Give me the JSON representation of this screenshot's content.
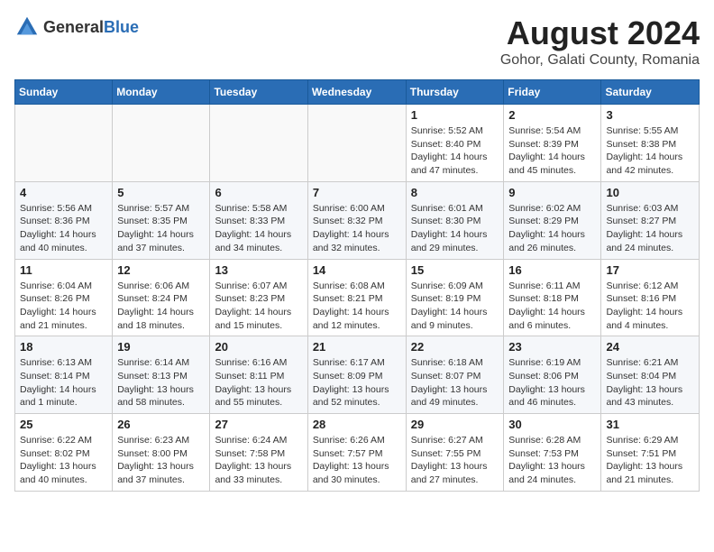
{
  "logo": {
    "general": "General",
    "blue": "Blue"
  },
  "title": "August 2024",
  "subtitle": "Gohor, Galati County, Romania",
  "days_of_week": [
    "Sunday",
    "Monday",
    "Tuesday",
    "Wednesday",
    "Thursday",
    "Friday",
    "Saturday"
  ],
  "weeks": [
    [
      {
        "day": "",
        "empty": true
      },
      {
        "day": "",
        "empty": true
      },
      {
        "day": "",
        "empty": true
      },
      {
        "day": "",
        "empty": true
      },
      {
        "day": "1",
        "sunrise": "5:52 AM",
        "sunset": "8:40 PM",
        "daylight": "14 hours and 47 minutes."
      },
      {
        "day": "2",
        "sunrise": "5:54 AM",
        "sunset": "8:39 PM",
        "daylight": "14 hours and 45 minutes."
      },
      {
        "day": "3",
        "sunrise": "5:55 AM",
        "sunset": "8:38 PM",
        "daylight": "14 hours and 42 minutes."
      }
    ],
    [
      {
        "day": "4",
        "sunrise": "5:56 AM",
        "sunset": "8:36 PM",
        "daylight": "14 hours and 40 minutes."
      },
      {
        "day": "5",
        "sunrise": "5:57 AM",
        "sunset": "8:35 PM",
        "daylight": "14 hours and 37 minutes."
      },
      {
        "day": "6",
        "sunrise": "5:58 AM",
        "sunset": "8:33 PM",
        "daylight": "14 hours and 34 minutes."
      },
      {
        "day": "7",
        "sunrise": "6:00 AM",
        "sunset": "8:32 PM",
        "daylight": "14 hours and 32 minutes."
      },
      {
        "day": "8",
        "sunrise": "6:01 AM",
        "sunset": "8:30 PM",
        "daylight": "14 hours and 29 minutes."
      },
      {
        "day": "9",
        "sunrise": "6:02 AM",
        "sunset": "8:29 PM",
        "daylight": "14 hours and 26 minutes."
      },
      {
        "day": "10",
        "sunrise": "6:03 AM",
        "sunset": "8:27 PM",
        "daylight": "14 hours and 24 minutes."
      }
    ],
    [
      {
        "day": "11",
        "sunrise": "6:04 AM",
        "sunset": "8:26 PM",
        "daylight": "14 hours and 21 minutes."
      },
      {
        "day": "12",
        "sunrise": "6:06 AM",
        "sunset": "8:24 PM",
        "daylight": "14 hours and 18 minutes."
      },
      {
        "day": "13",
        "sunrise": "6:07 AM",
        "sunset": "8:23 PM",
        "daylight": "14 hours and 15 minutes."
      },
      {
        "day": "14",
        "sunrise": "6:08 AM",
        "sunset": "8:21 PM",
        "daylight": "14 hours and 12 minutes."
      },
      {
        "day": "15",
        "sunrise": "6:09 AM",
        "sunset": "8:19 PM",
        "daylight": "14 hours and 9 minutes."
      },
      {
        "day": "16",
        "sunrise": "6:11 AM",
        "sunset": "8:18 PM",
        "daylight": "14 hours and 6 minutes."
      },
      {
        "day": "17",
        "sunrise": "6:12 AM",
        "sunset": "8:16 PM",
        "daylight": "14 hours and 4 minutes."
      }
    ],
    [
      {
        "day": "18",
        "sunrise": "6:13 AM",
        "sunset": "8:14 PM",
        "daylight": "14 hours and 1 minute."
      },
      {
        "day": "19",
        "sunrise": "6:14 AM",
        "sunset": "8:13 PM",
        "daylight": "13 hours and 58 minutes."
      },
      {
        "day": "20",
        "sunrise": "6:16 AM",
        "sunset": "8:11 PM",
        "daylight": "13 hours and 55 minutes."
      },
      {
        "day": "21",
        "sunrise": "6:17 AM",
        "sunset": "8:09 PM",
        "daylight": "13 hours and 52 minutes."
      },
      {
        "day": "22",
        "sunrise": "6:18 AM",
        "sunset": "8:07 PM",
        "daylight": "13 hours and 49 minutes."
      },
      {
        "day": "23",
        "sunrise": "6:19 AM",
        "sunset": "8:06 PM",
        "daylight": "13 hours and 46 minutes."
      },
      {
        "day": "24",
        "sunrise": "6:21 AM",
        "sunset": "8:04 PM",
        "daylight": "13 hours and 43 minutes."
      }
    ],
    [
      {
        "day": "25",
        "sunrise": "6:22 AM",
        "sunset": "8:02 PM",
        "daylight": "13 hours and 40 minutes."
      },
      {
        "day": "26",
        "sunrise": "6:23 AM",
        "sunset": "8:00 PM",
        "daylight": "13 hours and 37 minutes."
      },
      {
        "day": "27",
        "sunrise": "6:24 AM",
        "sunset": "7:58 PM",
        "daylight": "13 hours and 33 minutes."
      },
      {
        "day": "28",
        "sunrise": "6:26 AM",
        "sunset": "7:57 PM",
        "daylight": "13 hours and 30 minutes."
      },
      {
        "day": "29",
        "sunrise": "6:27 AM",
        "sunset": "7:55 PM",
        "daylight": "13 hours and 27 minutes."
      },
      {
        "day": "30",
        "sunrise": "6:28 AM",
        "sunset": "7:53 PM",
        "daylight": "13 hours and 24 minutes."
      },
      {
        "day": "31",
        "sunrise": "6:29 AM",
        "sunset": "7:51 PM",
        "daylight": "13 hours and 21 minutes."
      }
    ]
  ],
  "labels": {
    "sunrise": "Sunrise:",
    "sunset": "Sunset:",
    "daylight": "Daylight:"
  }
}
